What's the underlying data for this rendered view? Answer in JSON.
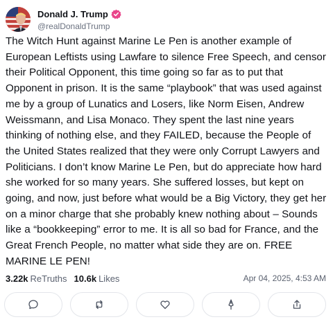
{
  "author": {
    "display_name": "Donald J. Trump",
    "handle": "@realDonaldTrump",
    "verified_icon": "verified-badge-icon",
    "verified_color": "#e9458a"
  },
  "post": {
    "text": "The Witch Hunt against Marine Le Pen is another example of European Leftists using Lawfare to silence Free Speech, and censor their Political Opponent, this time going so far as to put that Opponent in prison. It is the same “playbook” that was used against me by a group of Lunatics and Losers, like Norm Eisen, Andrew Weissmann, and Lisa Monaco. They spent the last nine years thinking of nothing else, and they FAILED, because the People of the United States realized that they were only Corrupt Lawyers and Politicians. I don’t know Marine Le Pen, but do appreciate how hard she worked for so many years. She suffered losses, but kept on going, and now, just before what would be a Big Victory, they get her on a minor charge that she probably knew nothing about – Sounds like a “bookkeeping” error to me. It is all so bad for France, and the Great French People, no matter what side they are on. FREE MARINE LE PEN!",
    "retruths_count": "3.22k",
    "retruths_label": "ReTruths",
    "likes_count": "10.6k",
    "likes_label": "Likes",
    "timestamp": "Apr 04, 2025, 4:53 AM"
  },
  "actions": [
    {
      "name": "reply",
      "icon": "comment-bubble-icon"
    },
    {
      "name": "retruth",
      "icon": "repost-arrows-icon"
    },
    {
      "name": "like",
      "icon": "heart-icon"
    },
    {
      "name": "quote",
      "icon": "quote-pen-icon"
    },
    {
      "name": "share",
      "icon": "share-upload-icon"
    }
  ],
  "colors": {
    "text": "#111318",
    "muted": "#5b6270",
    "border": "#e3e5ea"
  }
}
